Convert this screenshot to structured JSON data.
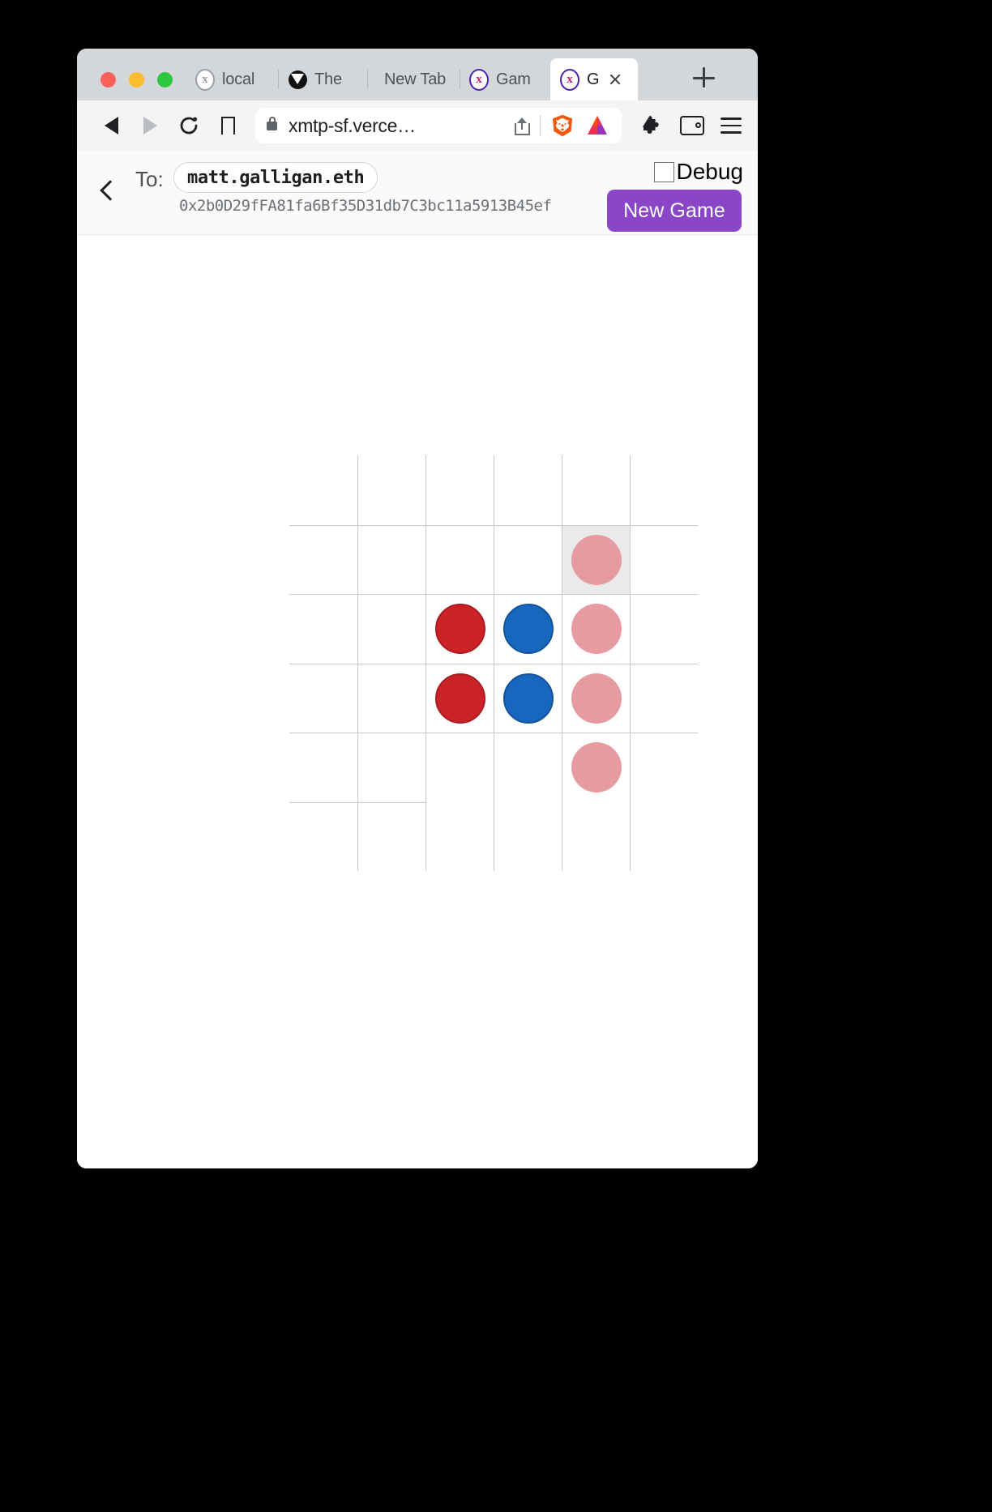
{
  "browser": {
    "traffic_lights": [
      "close",
      "minimize",
      "maximize"
    ],
    "tabs": [
      {
        "label": "local",
        "favicon": "xmtp-gray-icon",
        "active": false
      },
      {
        "label": "The",
        "favicon": "dark-triangle-icon",
        "active": false
      },
      {
        "label": "New Tab",
        "favicon": "blank-icon",
        "active": false
      },
      {
        "label": "Gam",
        "favicon": "xmtp-purple-icon",
        "active": false
      },
      {
        "label": "G",
        "favicon": "xmtp-purple-icon",
        "active": true
      }
    ],
    "new_tab_label": "+",
    "toolbar": {
      "back": "back",
      "forward": "forward",
      "reload": "reload",
      "bookmark": "bookmark",
      "url": "xmtp-sf.verce…",
      "share": "share",
      "brave_shields": "brave-lion",
      "bat_rewards": "bat-triangle",
      "extensions": "puzzle",
      "wallet": "wallet",
      "menu": "menu"
    }
  },
  "app": {
    "back_label": "Back",
    "to_label": "To:",
    "recipient_ens": "matt.galligan.eth",
    "recipient_address": "0x2b0D29fFA81fa6Bf35D31db7C3bc11a5913B45ef",
    "debug_label": "Debug",
    "debug_checked": false,
    "new_game_label": "New Game",
    "accent_purple": "#8b46c8"
  },
  "colors": {
    "tabstrip": "#d4d7da",
    "toolbar": "#f4f4f5",
    "page_header": "#fafafa",
    "grid_line": "#c9cacc",
    "cell_highlight": "#eaeaea",
    "piece_red": "#cc2127",
    "piece_red_border": "#aa1c22",
    "piece_blue": "#1867bf",
    "piece_blue_border": "#14539b",
    "piece_ghost": "#e69ba0"
  },
  "board": {
    "rows": 6,
    "cols": 6,
    "cells": [
      [
        {
          "piece": null,
          "highlight": false,
          "bt": false,
          "bl": false
        },
        {
          "piece": null,
          "highlight": false,
          "bt": false,
          "bl": true
        },
        {
          "piece": null,
          "highlight": false,
          "bt": false,
          "bl": true
        },
        {
          "piece": null,
          "highlight": false,
          "bt": false,
          "bl": true
        },
        {
          "piece": null,
          "highlight": false,
          "bt": false,
          "bl": true
        },
        {
          "piece": null,
          "highlight": false,
          "bt": false,
          "bl": true
        }
      ],
      [
        {
          "piece": null,
          "highlight": false,
          "bt": true,
          "bl": false
        },
        {
          "piece": null,
          "highlight": false,
          "bt": true,
          "bl": true
        },
        {
          "piece": null,
          "highlight": false,
          "bt": true,
          "bl": true
        },
        {
          "piece": null,
          "highlight": false,
          "bt": true,
          "bl": true
        },
        {
          "piece": "ghost",
          "highlight": true,
          "bt": true,
          "bl": true
        },
        {
          "piece": null,
          "highlight": false,
          "bt": true,
          "bl": true
        }
      ],
      [
        {
          "piece": null,
          "highlight": false,
          "bt": true,
          "bl": false
        },
        {
          "piece": null,
          "highlight": false,
          "bt": true,
          "bl": true
        },
        {
          "piece": "red",
          "highlight": false,
          "bt": true,
          "bl": true
        },
        {
          "piece": "blue",
          "highlight": false,
          "bt": true,
          "bl": true
        },
        {
          "piece": "ghost",
          "highlight": false,
          "bt": true,
          "bl": true
        },
        {
          "piece": null,
          "highlight": false,
          "bt": true,
          "bl": true
        }
      ],
      [
        {
          "piece": null,
          "highlight": false,
          "bt": true,
          "bl": false
        },
        {
          "piece": null,
          "highlight": false,
          "bt": true,
          "bl": true
        },
        {
          "piece": "red",
          "highlight": false,
          "bt": true,
          "bl": true
        },
        {
          "piece": "blue",
          "highlight": false,
          "bt": true,
          "bl": true
        },
        {
          "piece": "ghost",
          "highlight": false,
          "bt": true,
          "bl": true
        },
        {
          "piece": null,
          "highlight": false,
          "bt": true,
          "bl": true
        }
      ],
      [
        {
          "piece": null,
          "highlight": false,
          "bt": true,
          "bl": false
        },
        {
          "piece": null,
          "highlight": false,
          "bt": true,
          "bl": true
        },
        {
          "piece": null,
          "highlight": false,
          "bt": true,
          "bl": true
        },
        {
          "piece": null,
          "highlight": false,
          "bt": true,
          "bl": true
        },
        {
          "piece": "ghost",
          "highlight": false,
          "bt": true,
          "bl": true
        },
        {
          "piece": null,
          "highlight": false,
          "bt": true,
          "bl": true
        }
      ],
      [
        {
          "piece": null,
          "highlight": false,
          "bt": true,
          "bl": false
        },
        {
          "piece": null,
          "highlight": false,
          "bt": true,
          "bl": true
        },
        {
          "piece": null,
          "highlight": false,
          "bt": false,
          "bl": true
        },
        {
          "piece": null,
          "highlight": false,
          "bt": false,
          "bl": true
        },
        {
          "piece": null,
          "highlight": false,
          "bt": false,
          "bl": true
        },
        {
          "piece": null,
          "highlight": false,
          "bt": false,
          "bl": true
        }
      ]
    ]
  }
}
